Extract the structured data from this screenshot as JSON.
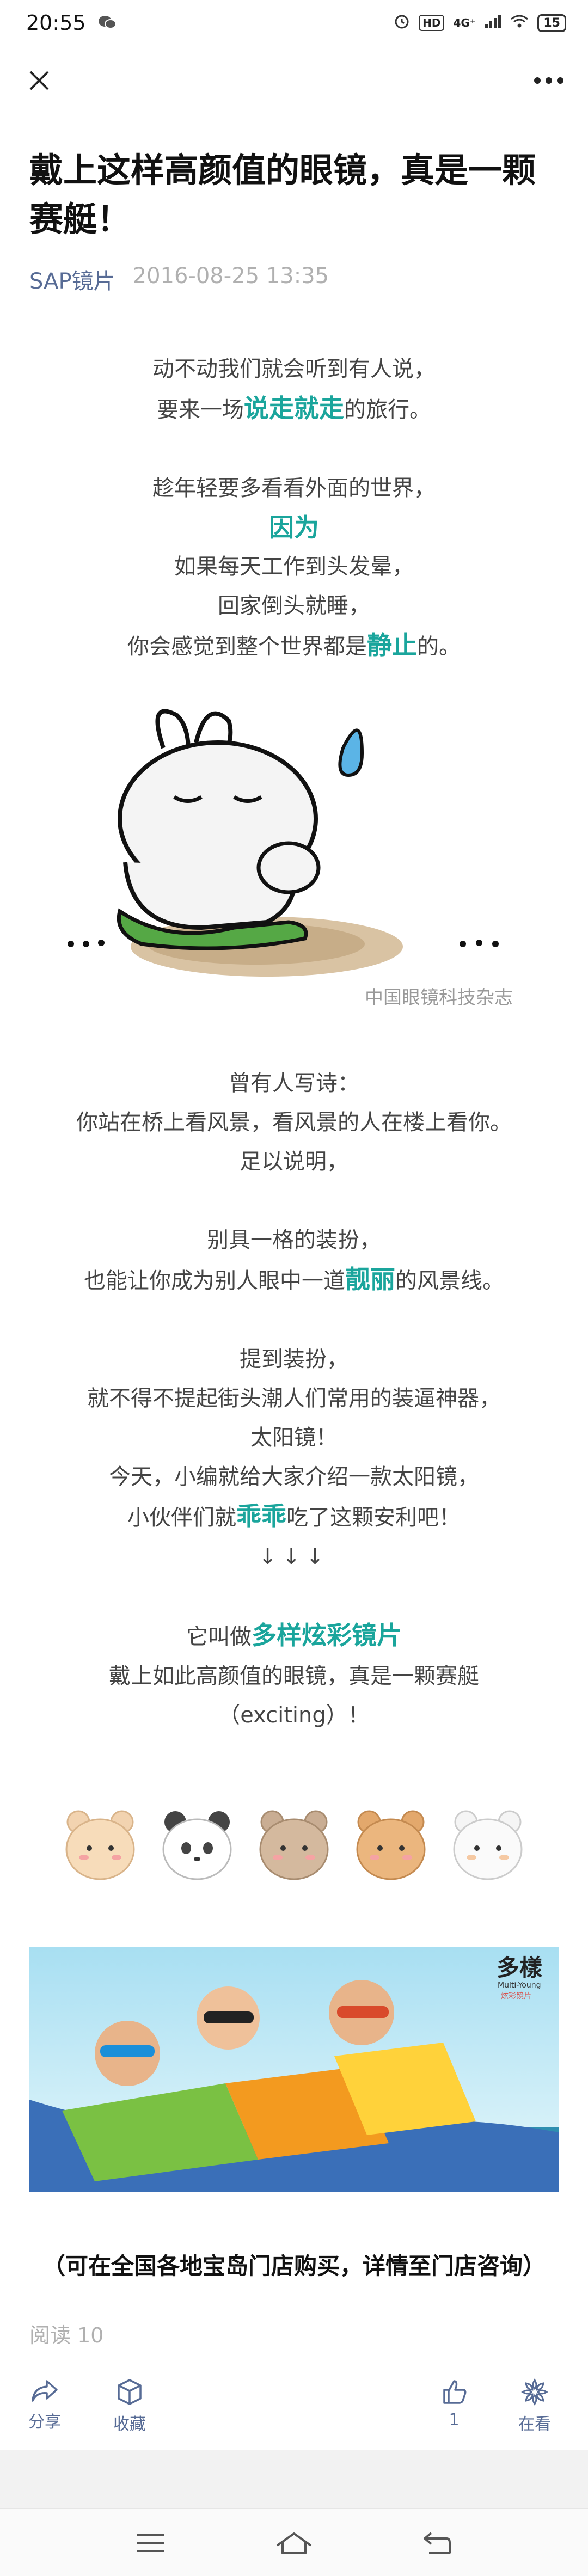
{
  "status": {
    "time": "20:55",
    "network": "4G⁺",
    "battery": "15",
    "hd": "HD"
  },
  "article": {
    "title": "戴上这样高颜值的眼镜，真是一颗赛艇！",
    "author": "SAP镜片",
    "date": "2016-08-25 13:35",
    "p1": {
      "l1": "动不动我们就会听到有人说，",
      "l2a": "要来一场",
      "l2hl": "说走就走",
      "l2b": "的旅行。"
    },
    "p2": {
      "l1": "趁年轻要多看看外面的世界，",
      "hl": "因为",
      "l3": "如果每天工作到头发晕，",
      "l4": "回家倒头就睡，",
      "l5a": "你会感觉到整个世界都是",
      "l5hl": "静止",
      "l5b": "的。"
    },
    "watermark": "中国眼镜科技杂志",
    "p3": {
      "l1": "曾有人写诗：",
      "l2": "你站在桥上看风景，看风景的人在楼上看你。",
      "l3": "足以说明，"
    },
    "p4": {
      "l1": "别具一格的装扮，",
      "l2a": "也能让你成为别人眼中一道",
      "l2hl": "靓丽",
      "l2b": "的风景线。"
    },
    "p5": {
      "l1": "提到装扮，",
      "l2": "就不得不提起街头潮人们常用的装逼神器，",
      "l3": "太阳镜！",
      "l4": "今天，小编就给大家介绍一款太阳镜，",
      "l5a": "小伙伴们就",
      "l5hl": "乖乖",
      "l5b": "吃了这颗安利吧！",
      "arrows": "↓↓↓"
    },
    "p6": {
      "l1a": "它叫做",
      "l1hl": "多样炫彩镜片",
      "l2": "戴上如此高颜值的眼镜，真是一颗赛艇",
      "l3": "（exciting）！"
    },
    "banner": {
      "brand": "多樣",
      "brand_en": "Multi-Young",
      "brand_sub": "炫彩镜片"
    },
    "footnote": "（可在全国各地宝岛门店购买，详情至门店咨询）",
    "read_count": "阅读 10"
  },
  "actions": {
    "share": "分享",
    "collect": "收藏",
    "like_count": "1",
    "looking": "在看"
  },
  "colors": {
    "accent": "#1aa59c",
    "link": "#576b95",
    "meta_gray": "#b0b0b0"
  }
}
